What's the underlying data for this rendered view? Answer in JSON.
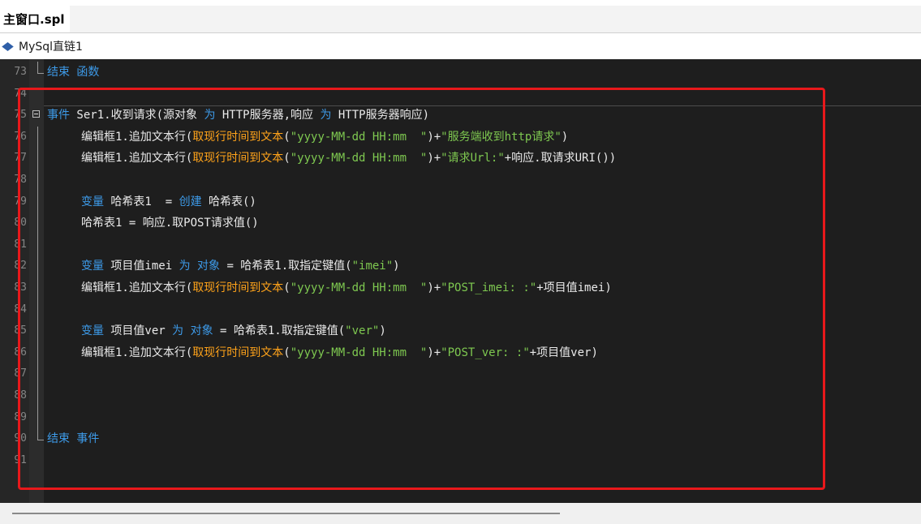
{
  "tab": {
    "title": "主窗口.spl"
  },
  "breadcrumb": {
    "label": "MySql直链1",
    "icon": "diamond-icon"
  },
  "lines": [
    {
      "num": "73",
      "segments": [
        {
          "t": "结束 函数",
          "c": "kw"
        }
      ]
    },
    {
      "num": "74",
      "segments": []
    },
    {
      "num": "75",
      "segments": [
        {
          "t": "事件",
          "c": "kw"
        },
        {
          "t": " Ser1.收到请求(源对象 ",
          "c": "pl"
        },
        {
          "t": "为",
          "c": "kw"
        },
        {
          "t": " HTTP服务器,响应 ",
          "c": "pl"
        },
        {
          "t": "为",
          "c": "kw"
        },
        {
          "t": " HTTP服务器响应)",
          "c": "pl"
        }
      ]
    },
    {
      "num": "76",
      "segments": [
        {
          "t": "编辑框1.追加文本行(",
          "c": "pl"
        },
        {
          "t": "取现行时间到文本",
          "c": "fn"
        },
        {
          "t": "(",
          "c": "pl"
        },
        {
          "t": "\"yyyy-MM-dd HH:mm  \"",
          "c": "st"
        },
        {
          "t": ")+",
          "c": "pl"
        },
        {
          "t": "\"服务端收到http请求\"",
          "c": "st"
        },
        {
          "t": ")",
          "c": "pl"
        }
      ]
    },
    {
      "num": "77",
      "segments": [
        {
          "t": "编辑框1.追加文本行(",
          "c": "pl"
        },
        {
          "t": "取现行时间到文本",
          "c": "fn"
        },
        {
          "t": "(",
          "c": "pl"
        },
        {
          "t": "\"yyyy-MM-dd HH:mm  \"",
          "c": "st"
        },
        {
          "t": ")+",
          "c": "pl"
        },
        {
          "t": "\"请求Url:\"",
          "c": "st"
        },
        {
          "t": "+响应.取请求URI())",
          "c": "pl"
        }
      ]
    },
    {
      "num": "78",
      "segments": []
    },
    {
      "num": "79",
      "segments": [
        {
          "t": "变量",
          "c": "kw"
        },
        {
          "t": " 哈希表1  = ",
          "c": "pl"
        },
        {
          "t": "创建",
          "c": "kw"
        },
        {
          "t": " 哈希表()",
          "c": "pl"
        }
      ]
    },
    {
      "num": "80",
      "segments": [
        {
          "t": "哈希表1 = 响应.取POST请求值()",
          "c": "pl"
        }
      ]
    },
    {
      "num": "81",
      "segments": []
    },
    {
      "num": "82",
      "segments": [
        {
          "t": "变量",
          "c": "kw"
        },
        {
          "t": " 项目值imei ",
          "c": "pl"
        },
        {
          "t": "为",
          "c": "kw"
        },
        {
          "t": " ",
          "c": "pl"
        },
        {
          "t": "对象",
          "c": "kw"
        },
        {
          "t": " = 哈希表1.取指定键值(",
          "c": "pl"
        },
        {
          "t": "\"imei\"",
          "c": "st"
        },
        {
          "t": ")",
          "c": "pl"
        }
      ]
    },
    {
      "num": "83",
      "segments": [
        {
          "t": "编辑框1.追加文本行(",
          "c": "pl"
        },
        {
          "t": "取现行时间到文本",
          "c": "fn"
        },
        {
          "t": "(",
          "c": "pl"
        },
        {
          "t": "\"yyyy-MM-dd HH:mm  \"",
          "c": "st"
        },
        {
          "t": ")+",
          "c": "pl"
        },
        {
          "t": "\"POST_imei: :\"",
          "c": "st"
        },
        {
          "t": "+项目值imei)",
          "c": "pl"
        }
      ]
    },
    {
      "num": "84",
      "segments": []
    },
    {
      "num": "85",
      "segments": [
        {
          "t": "变量",
          "c": "kw"
        },
        {
          "t": " 项目值ver ",
          "c": "pl"
        },
        {
          "t": "为",
          "c": "kw"
        },
        {
          "t": " ",
          "c": "pl"
        },
        {
          "t": "对象",
          "c": "kw"
        },
        {
          "t": " = 哈希表1.取指定键值(",
          "c": "pl"
        },
        {
          "t": "\"ver\"",
          "c": "st"
        },
        {
          "t": ")",
          "c": "pl"
        }
      ]
    },
    {
      "num": "86",
      "segments": [
        {
          "t": "编辑框1.追加文本行(",
          "c": "pl"
        },
        {
          "t": "取现行时间到文本",
          "c": "fn"
        },
        {
          "t": "(",
          "c": "pl"
        },
        {
          "t": "\"yyyy-MM-dd HH:mm  \"",
          "c": "st"
        },
        {
          "t": ")+",
          "c": "pl"
        },
        {
          "t": "\"POST_ver: :\"",
          "c": "st"
        },
        {
          "t": "+项目值ver)",
          "c": "pl"
        }
      ]
    },
    {
      "num": "87",
      "segments": []
    },
    {
      "num": "88",
      "segments": []
    },
    {
      "num": "89",
      "segments": []
    },
    {
      "num": "90",
      "segments": [
        {
          "t": "结束 事件",
          "c": "kw"
        }
      ]
    },
    {
      "num": "91",
      "segments": []
    }
  ],
  "colors": {
    "keyword": "#3d9ae8",
    "plain": "#eaeaea",
    "function": "#ffa31a",
    "string": "#7ec850",
    "editor_bg": "#1e1e1e",
    "highlight": "#e8181b"
  }
}
